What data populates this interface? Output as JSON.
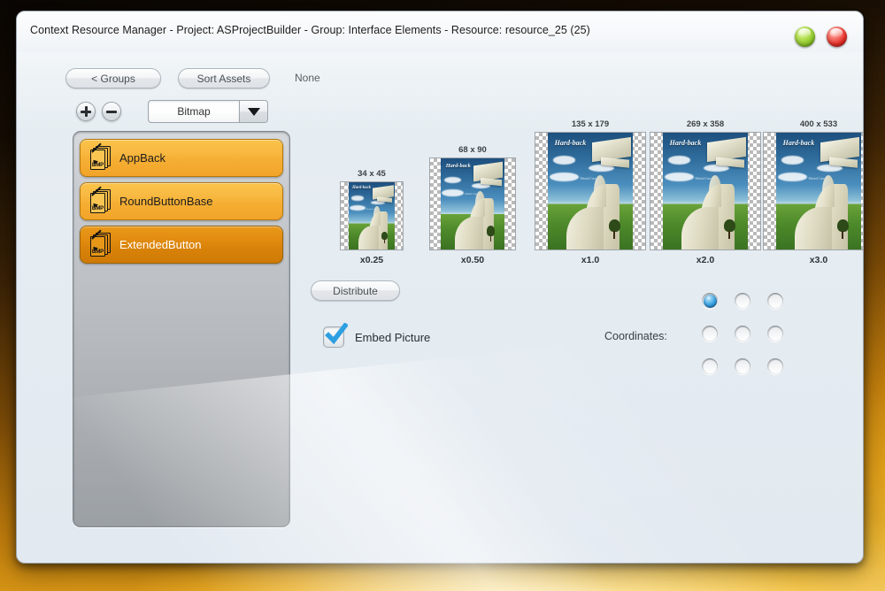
{
  "window": {
    "title": "Context Resource Manager - Project: ASProjectBuilder - Group: Interface Elements - Resource: resource_25 (25)",
    "minimize_tooltip": "Minimize",
    "close_tooltip": "Close",
    "accent_orange": "#f2a42a",
    "accent_selected_orange": "#d9830a",
    "accent_blue": "#3ba2e0"
  },
  "toolbar": {
    "groups_label": "< Groups",
    "sort_label": "Sort Assets",
    "status_label": "None",
    "add_label": "+",
    "remove_label": "-",
    "type_value": "Bitmap",
    "type_options": [
      "Bitmap"
    ]
  },
  "asset_list": {
    "items": [
      {
        "label": "AppBack",
        "icon": "bmp-file-icon",
        "badge": "BMP",
        "selected": false
      },
      {
        "label": "RoundButtonBase",
        "icon": "bmp-file-icon",
        "badge": "BMP",
        "selected": false
      },
      {
        "label": "ExtendedButton",
        "icon": "bmp-file-icon",
        "badge": "BMP",
        "selected": true
      }
    ]
  },
  "preview": {
    "artwork_title": "Hard-back",
    "artwork_subtitle": "Mental Case",
    "thumbnails": [
      {
        "dims": "34 x 45",
        "scale": "x0.25"
      },
      {
        "dims": "68 x 90",
        "scale": "x0.50"
      },
      {
        "dims": "135 x 179",
        "scale": "x1.0"
      },
      {
        "dims": "269 x 358",
        "scale": "x2.0"
      },
      {
        "dims": "400 x 533",
        "scale": "x3.0"
      }
    ]
  },
  "options": {
    "distribute_label": "Distribute",
    "embed_label": "Embed Picture",
    "embed_checked": true,
    "coordinates_label": "Coordinates:",
    "coordinates_selected_index": 0,
    "coordinates_cells": [
      "top-left",
      "top-center",
      "top-right",
      "middle-left",
      "middle-center",
      "middle-right",
      "bottom-left",
      "bottom-center",
      "bottom-right"
    ]
  }
}
